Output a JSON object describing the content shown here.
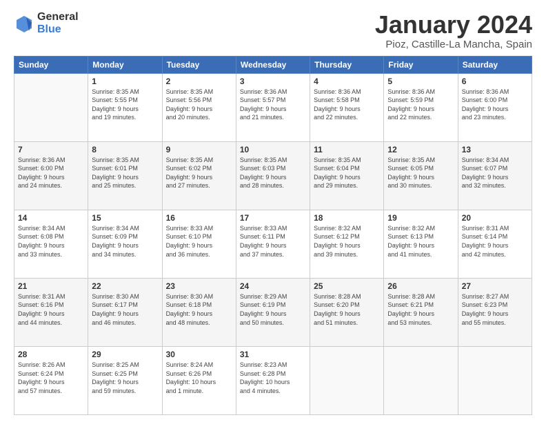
{
  "logo": {
    "general": "General",
    "blue": "Blue"
  },
  "header": {
    "month": "January 2024",
    "location": "Pioz, Castille-La Mancha, Spain"
  },
  "weekdays": [
    "Sunday",
    "Monday",
    "Tuesday",
    "Wednesday",
    "Thursday",
    "Friday",
    "Saturday"
  ],
  "weeks": [
    [
      {
        "day": "",
        "info": ""
      },
      {
        "day": "1",
        "info": "Sunrise: 8:35 AM\nSunset: 5:55 PM\nDaylight: 9 hours\nand 19 minutes."
      },
      {
        "day": "2",
        "info": "Sunrise: 8:35 AM\nSunset: 5:56 PM\nDaylight: 9 hours\nand 20 minutes."
      },
      {
        "day": "3",
        "info": "Sunrise: 8:36 AM\nSunset: 5:57 PM\nDaylight: 9 hours\nand 21 minutes."
      },
      {
        "day": "4",
        "info": "Sunrise: 8:36 AM\nSunset: 5:58 PM\nDaylight: 9 hours\nand 22 minutes."
      },
      {
        "day": "5",
        "info": "Sunrise: 8:36 AM\nSunset: 5:59 PM\nDaylight: 9 hours\nand 22 minutes."
      },
      {
        "day": "6",
        "info": "Sunrise: 8:36 AM\nSunset: 6:00 PM\nDaylight: 9 hours\nand 23 minutes."
      }
    ],
    [
      {
        "day": "7",
        "info": "Sunrise: 8:36 AM\nSunset: 6:00 PM\nDaylight: 9 hours\nand 24 minutes."
      },
      {
        "day": "8",
        "info": "Sunrise: 8:35 AM\nSunset: 6:01 PM\nDaylight: 9 hours\nand 25 minutes."
      },
      {
        "day": "9",
        "info": "Sunrise: 8:35 AM\nSunset: 6:02 PM\nDaylight: 9 hours\nand 27 minutes."
      },
      {
        "day": "10",
        "info": "Sunrise: 8:35 AM\nSunset: 6:03 PM\nDaylight: 9 hours\nand 28 minutes."
      },
      {
        "day": "11",
        "info": "Sunrise: 8:35 AM\nSunset: 6:04 PM\nDaylight: 9 hours\nand 29 minutes."
      },
      {
        "day": "12",
        "info": "Sunrise: 8:35 AM\nSunset: 6:05 PM\nDaylight: 9 hours\nand 30 minutes."
      },
      {
        "day": "13",
        "info": "Sunrise: 8:34 AM\nSunset: 6:07 PM\nDaylight: 9 hours\nand 32 minutes."
      }
    ],
    [
      {
        "day": "14",
        "info": "Sunrise: 8:34 AM\nSunset: 6:08 PM\nDaylight: 9 hours\nand 33 minutes."
      },
      {
        "day": "15",
        "info": "Sunrise: 8:34 AM\nSunset: 6:09 PM\nDaylight: 9 hours\nand 34 minutes."
      },
      {
        "day": "16",
        "info": "Sunrise: 8:33 AM\nSunset: 6:10 PM\nDaylight: 9 hours\nand 36 minutes."
      },
      {
        "day": "17",
        "info": "Sunrise: 8:33 AM\nSunset: 6:11 PM\nDaylight: 9 hours\nand 37 minutes."
      },
      {
        "day": "18",
        "info": "Sunrise: 8:32 AM\nSunset: 6:12 PM\nDaylight: 9 hours\nand 39 minutes."
      },
      {
        "day": "19",
        "info": "Sunrise: 8:32 AM\nSunset: 6:13 PM\nDaylight: 9 hours\nand 41 minutes."
      },
      {
        "day": "20",
        "info": "Sunrise: 8:31 AM\nSunset: 6:14 PM\nDaylight: 9 hours\nand 42 minutes."
      }
    ],
    [
      {
        "day": "21",
        "info": "Sunrise: 8:31 AM\nSunset: 6:16 PM\nDaylight: 9 hours\nand 44 minutes."
      },
      {
        "day": "22",
        "info": "Sunrise: 8:30 AM\nSunset: 6:17 PM\nDaylight: 9 hours\nand 46 minutes."
      },
      {
        "day": "23",
        "info": "Sunrise: 8:30 AM\nSunset: 6:18 PM\nDaylight: 9 hours\nand 48 minutes."
      },
      {
        "day": "24",
        "info": "Sunrise: 8:29 AM\nSunset: 6:19 PM\nDaylight: 9 hours\nand 50 minutes."
      },
      {
        "day": "25",
        "info": "Sunrise: 8:28 AM\nSunset: 6:20 PM\nDaylight: 9 hours\nand 51 minutes."
      },
      {
        "day": "26",
        "info": "Sunrise: 8:28 AM\nSunset: 6:21 PM\nDaylight: 9 hours\nand 53 minutes."
      },
      {
        "day": "27",
        "info": "Sunrise: 8:27 AM\nSunset: 6:23 PM\nDaylight: 9 hours\nand 55 minutes."
      }
    ],
    [
      {
        "day": "28",
        "info": "Sunrise: 8:26 AM\nSunset: 6:24 PM\nDaylight: 9 hours\nand 57 minutes."
      },
      {
        "day": "29",
        "info": "Sunrise: 8:25 AM\nSunset: 6:25 PM\nDaylight: 9 hours\nand 59 minutes."
      },
      {
        "day": "30",
        "info": "Sunrise: 8:24 AM\nSunset: 6:26 PM\nDaylight: 10 hours\nand 1 minute."
      },
      {
        "day": "31",
        "info": "Sunrise: 8:23 AM\nSunset: 6:28 PM\nDaylight: 10 hours\nand 4 minutes."
      },
      {
        "day": "",
        "info": ""
      },
      {
        "day": "",
        "info": ""
      },
      {
        "day": "",
        "info": ""
      }
    ]
  ]
}
